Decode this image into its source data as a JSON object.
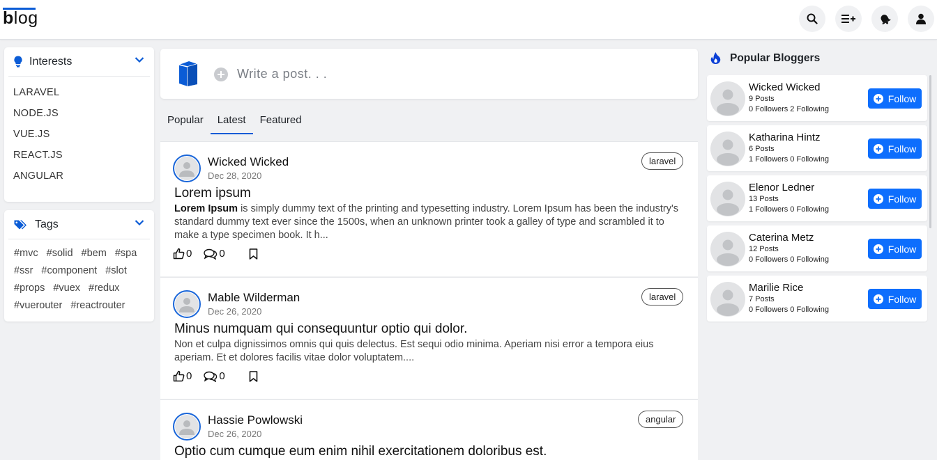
{
  "brand": {
    "logo_bold": "b",
    "logo_rest": "log"
  },
  "interests": {
    "title": "Interests",
    "items": [
      "LARAVEL",
      "NODE.JS",
      "VUE.JS",
      "REACT.JS",
      "ANGULAR"
    ]
  },
  "tags": {
    "title": "Tags",
    "items": [
      "#mvc",
      "#solid",
      "#bem",
      "#spa",
      "#ssr",
      "#component",
      "#slot",
      "#props",
      "#vuex",
      "#redux",
      "#vuerouter",
      "#reactrouter"
    ]
  },
  "composer": {
    "placeholder": "Write a post. . ."
  },
  "tabs": [
    "Popular",
    "Latest",
    "Featured"
  ],
  "active_tab": "Latest",
  "posts": [
    {
      "author": "Wicked Wicked",
      "date": "Dec 28, 2020",
      "tag": "laravel",
      "title": "Lorem ipsum",
      "excerpt_bold": "Lorem Ipsum",
      "excerpt": " is simply dummy text of the printing and typesetting industry. Lorem Ipsum has been the industry's standard dummy text ever since the 1500s, when an unknown printer took a galley of type and scrambled it to make a type specimen book. It h...",
      "likes": "0",
      "comments": "0"
    },
    {
      "author": "Mable Wilderman",
      "date": "Dec 26, 2020",
      "tag": "laravel",
      "title": "Minus numquam qui consequuntur optio qui dolor.",
      "excerpt_bold": "",
      "excerpt": "Non et culpa dignissimos omnis qui quis delectus. Est sequi odio minima. Aperiam nisi error a tempora eius aperiam. Et et dolores facilis vitae dolor voluptatem....",
      "likes": "0",
      "comments": "0"
    },
    {
      "author": "Hassie Powlowski",
      "date": "Dec 26, 2020",
      "tag": "angular",
      "title": "Optio cum cumque eum enim nihil exercitationem doloribus est.",
      "excerpt_bold": "",
      "excerpt": "",
      "likes": "",
      "comments": ""
    }
  ],
  "popular_bloggers": {
    "title": "Popular Bloggers",
    "follow_label": "Follow",
    "items": [
      {
        "name": "Wicked Wicked",
        "posts": "9 Posts",
        "followers": "0 Followers 2 Following"
      },
      {
        "name": "Katharina Hintz",
        "posts": "6 Posts",
        "followers": "1 Followers 0 Following"
      },
      {
        "name": "Elenor Ledner",
        "posts": "13 Posts",
        "followers": "1 Followers 0 Following"
      },
      {
        "name": "Caterina Metz",
        "posts": "12 Posts",
        "followers": "0 Followers 0 Following"
      },
      {
        "name": "Marilie Rice",
        "posts": "7 Posts",
        "followers": "0 Followers 0 Following"
      }
    ]
  },
  "icons": {
    "top": [
      "search-icon",
      "add-list-icon",
      "notification-bell-icon",
      "user-icon"
    ],
    "accent": "#0b5cd6",
    "button": "#0d6efd"
  }
}
